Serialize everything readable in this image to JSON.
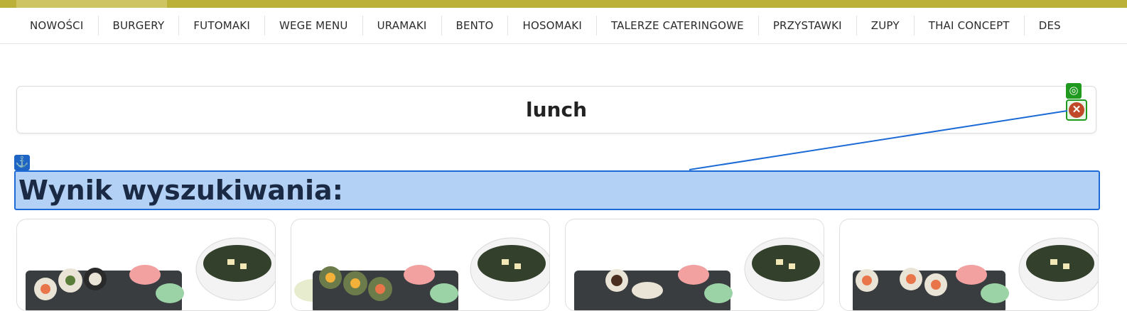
{
  "nav": {
    "items": [
      {
        "label": "NOWOŚCI"
      },
      {
        "label": "BURGERY"
      },
      {
        "label": "FUTOMAKI"
      },
      {
        "label": "WEGE MENU"
      },
      {
        "label": "URAMAKI"
      },
      {
        "label": "BENTO"
      },
      {
        "label": "HOSOMAKI"
      },
      {
        "label": "TALERZE CATERINGOWE"
      },
      {
        "label": "PRZYSTAWKI"
      },
      {
        "label": "ZUPY"
      },
      {
        "label": "THAI CONCEPT"
      },
      {
        "label": "DES"
      }
    ]
  },
  "search": {
    "value": "lunch",
    "clear_icon": "close-circle-icon",
    "target_icon": "target-icon"
  },
  "results": {
    "heading": "Wynik wyszukiwania:",
    "anchor_icon": "anchor-icon",
    "cards": [
      {
        "image": "lunch-set-image-1"
      },
      {
        "image": "lunch-set-image-2"
      },
      {
        "image": "lunch-set-image-3"
      },
      {
        "image": "lunch-set-image-4"
      }
    ]
  },
  "colors": {
    "brand_bar": "#bcb138",
    "highlight_fill": "#b3d1f5",
    "highlight_border": "#1c6ad6",
    "clear_button": "#c0492a",
    "badge_green": "#1f9a1f"
  }
}
